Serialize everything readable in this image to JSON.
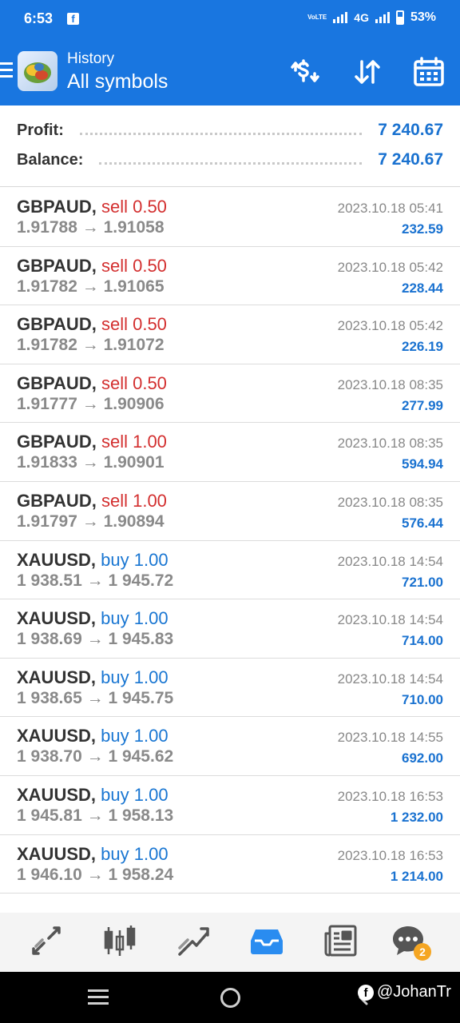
{
  "status_bar": {
    "time": "6:53",
    "volte": "VoLTE",
    "network": "4G",
    "battery": "53%"
  },
  "app_bar": {
    "title": "History",
    "subtitle": "All symbols",
    "actions": [
      "currency-exchange-icon",
      "sort-icon",
      "calendar-icon"
    ]
  },
  "summary": {
    "profit_label": "Profit:",
    "profit_value": "7 240.67",
    "balance_label": "Balance:",
    "balance_value": "7 240.67"
  },
  "trades": [
    {
      "symbol": "GBPAUD,",
      "side": "sell",
      "volume": "0.50",
      "open": "1.91788",
      "close": "1.91058",
      "time": "2023.10.18 05:41",
      "profit": "232.59"
    },
    {
      "symbol": "GBPAUD,",
      "side": "sell",
      "volume": "0.50",
      "open": "1.91782",
      "close": "1.91065",
      "time": "2023.10.18 05:42",
      "profit": "228.44"
    },
    {
      "symbol": "GBPAUD,",
      "side": "sell",
      "volume": "0.50",
      "open": "1.91782",
      "close": "1.91072",
      "time": "2023.10.18 05:42",
      "profit": "226.19"
    },
    {
      "symbol": "GBPAUD,",
      "side": "sell",
      "volume": "0.50",
      "open": "1.91777",
      "close": "1.90906",
      "time": "2023.10.18 08:35",
      "profit": "277.99"
    },
    {
      "symbol": "GBPAUD,",
      "side": "sell",
      "volume": "1.00",
      "open": "1.91833",
      "close": "1.90901",
      "time": "2023.10.18 08:35",
      "profit": "594.94"
    },
    {
      "symbol": "GBPAUD,",
      "side": "sell",
      "volume": "1.00",
      "open": "1.91797",
      "close": "1.90894",
      "time": "2023.10.18 08:35",
      "profit": "576.44"
    },
    {
      "symbol": "XAUUSD,",
      "side": "buy",
      "volume": "1.00",
      "open": "1 938.51",
      "close": "1 945.72",
      "time": "2023.10.18 14:54",
      "profit": "721.00"
    },
    {
      "symbol": "XAUUSD,",
      "side": "buy",
      "volume": "1.00",
      "open": "1 938.69",
      "close": "1 945.83",
      "time": "2023.10.18 14:54",
      "profit": "714.00"
    },
    {
      "symbol": "XAUUSD,",
      "side": "buy",
      "volume": "1.00",
      "open": "1 938.65",
      "close": "1 945.75",
      "time": "2023.10.18 14:54",
      "profit": "710.00"
    },
    {
      "symbol": "XAUUSD,",
      "side": "buy",
      "volume": "1.00",
      "open": "1 938.70",
      "close": "1 945.62",
      "time": "2023.10.18 14:55",
      "profit": "692.00"
    },
    {
      "symbol": "XAUUSD,",
      "side": "buy",
      "volume": "1.00",
      "open": "1 945.81",
      "close": "1 958.13",
      "time": "2023.10.18 16:53",
      "profit": "1 232.00"
    },
    {
      "symbol": "XAUUSD,",
      "side": "buy",
      "volume": "1.00",
      "open": "1 946.10",
      "close": "1 958.24",
      "time": "2023.10.18 16:53",
      "profit": "1 214.00"
    }
  ],
  "bottom_nav": {
    "items": [
      "quotes-icon",
      "chart-icon",
      "trade-icon",
      "history-icon",
      "news-icon",
      "chat-icon"
    ],
    "active": "history-icon",
    "chat_badge": "2"
  },
  "watermark": {
    "handle": "@JohanTr"
  },
  "colors": {
    "primary": "#1976e0",
    "sell": "#d32f2f",
    "buy": "#1976d2",
    "profit": "#1a72d0"
  }
}
